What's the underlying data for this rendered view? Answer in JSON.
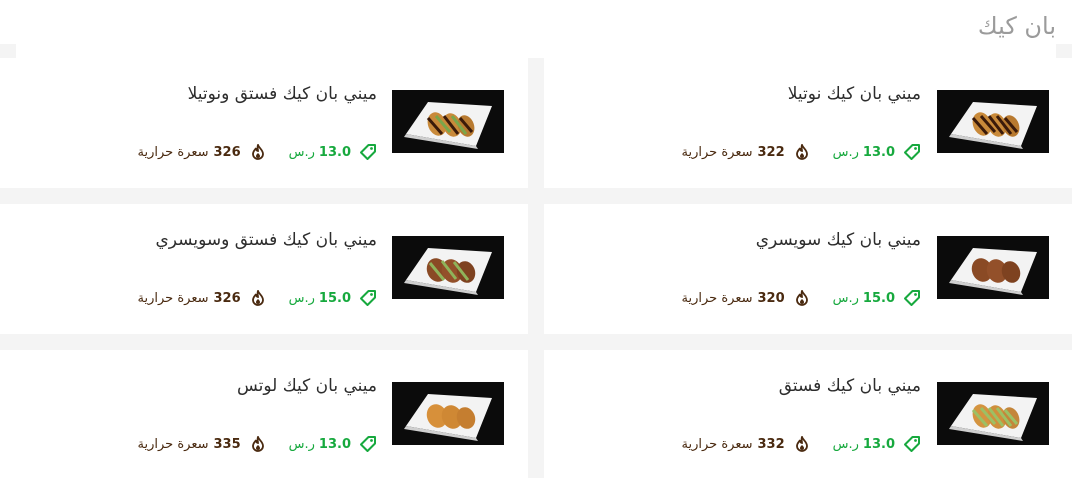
{
  "section": {
    "title": "بان كيك"
  },
  "colors": {
    "price": "#17a93e",
    "calories": "#4a2a10",
    "title": "#9b9b9b"
  },
  "items": [
    {
      "name": "ميني بان كيك نوتيلا",
      "price": "13.0",
      "currency": "ر.س",
      "calories": "322",
      "calories_label": "سعرة حرارية",
      "image": "chocolate"
    },
    {
      "name": "ميني بان كيك فستق ونوتيلا",
      "price": "13.0",
      "currency": "ر.س",
      "calories": "326",
      "calories_label": "سعرة حرارية",
      "image": "pistachio-chocolate"
    },
    {
      "name": "ميني بان كيك سويسري",
      "price": "15.0",
      "currency": "ر.س",
      "calories": "320",
      "calories_label": "سعرة حرارية",
      "image": "cocoa"
    },
    {
      "name": "ميني بان كيك فستق وسويسري",
      "price": "15.0",
      "currency": "ر.س",
      "calories": "326",
      "calories_label": "سعرة حرارية",
      "image": "pistachio-cocoa"
    },
    {
      "name": "ميني بان كيك فستق",
      "price": "13.0",
      "currency": "ر.س",
      "calories": "332",
      "calories_label": "سعرة حرارية",
      "image": "pistachio"
    },
    {
      "name": "ميني بان كيك لوتس",
      "price": "13.0",
      "currency": "ر.س",
      "calories": "335",
      "calories_label": "سعرة حرارية",
      "image": "lotus"
    }
  ]
}
